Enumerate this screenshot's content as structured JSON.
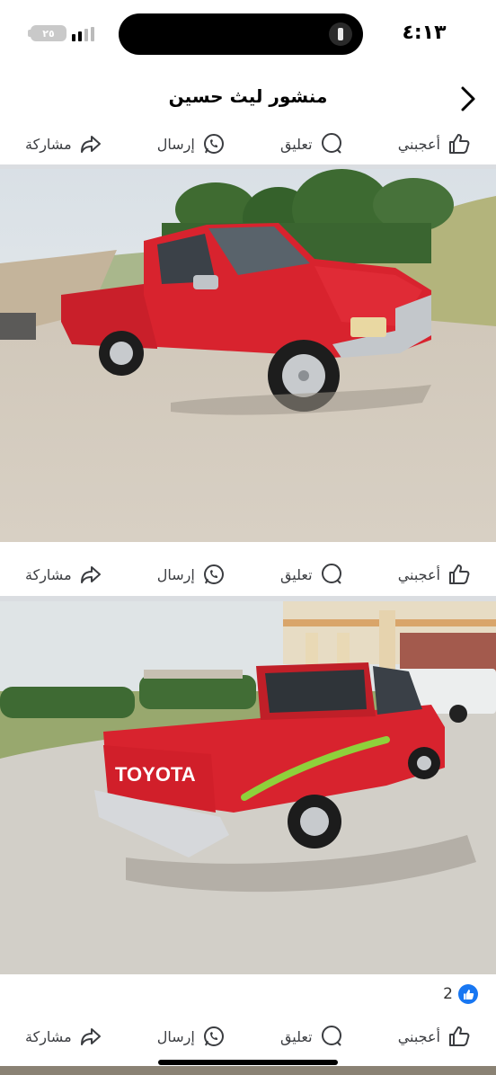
{
  "status_bar": {
    "time": "٤:١٣",
    "battery_level": "٢٥",
    "icons": [
      "battery-icon",
      "cellular-signal-icon",
      "flashlight-icon"
    ]
  },
  "header": {
    "title": "منشور ليث حسين",
    "back_icon": "chevron-icon"
  },
  "actions": {
    "like": "أعجبني",
    "comment": "تعليق",
    "send": "إرسال",
    "share": "مشاركة",
    "icons": [
      "thumbs-up-icon",
      "comment-bubble-icon",
      "whatsapp-icon",
      "share-arrow-icon"
    ]
  },
  "photos": [
    {
      "description_icon": "red-pickup-front-photo"
    },
    {
      "description_icon": "red-pickup-rear-photo",
      "tailgate_text": "TOYOTA"
    }
  ],
  "reactions": {
    "count": "2",
    "icon": "like-reaction-icon"
  },
  "colors": {
    "accent": "#1877f2",
    "truck_red": "#d8232e",
    "divider": "#dadde1"
  }
}
